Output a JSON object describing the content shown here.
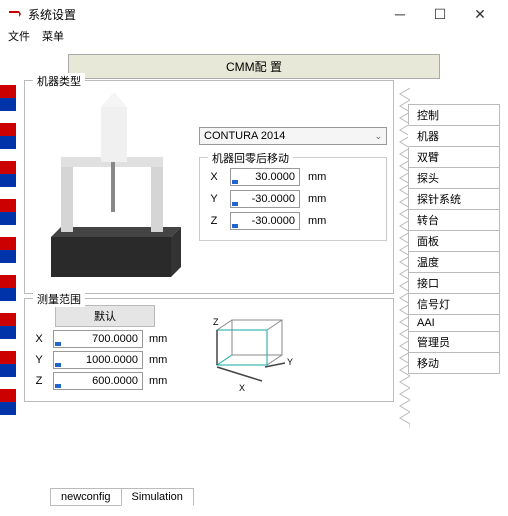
{
  "window": {
    "title": "系统设置"
  },
  "menu": {
    "file": "文件",
    "menu_item": "菜单"
  },
  "banner": "CMM配 置",
  "machine_type": {
    "group": "机器类型",
    "selected": "CONTURA 2014"
  },
  "homing": {
    "group": "机器回零后移动",
    "x_label": "X",
    "x_value": "30.0000",
    "y_label": "Y",
    "y_value": "-30.0000",
    "z_label": "Z",
    "z_value": "-30.0000",
    "unit": "mm"
  },
  "range": {
    "group": "测量范围",
    "default_header": "默认",
    "x_label": "X",
    "x_value": "700.0000",
    "y_label": "Y",
    "y_value": "1000.0000",
    "z_label": "Z",
    "z_value": "600.0000",
    "unit": "mm",
    "axes": {
      "x": "X",
      "y": "Y",
      "z": "Z"
    }
  },
  "tabs": {
    "items": [
      "控制",
      "机器",
      "双臂",
      "探头",
      "探针系统",
      "转台",
      "面板",
      "温度",
      "接口",
      "信号灯",
      "AAI",
      "管理员",
      "移动"
    ],
    "active": "机器"
  },
  "bottom_tabs": {
    "items": [
      "newconfig",
      "Simulation"
    ],
    "active": "Simulation"
  }
}
